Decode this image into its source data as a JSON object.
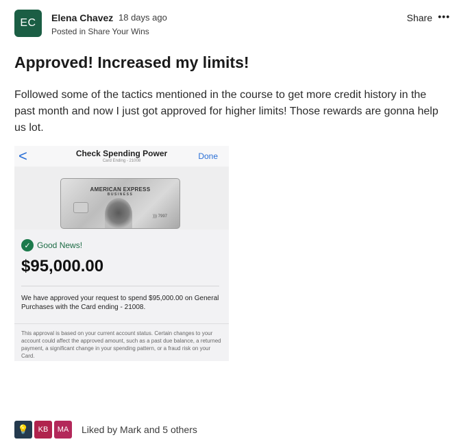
{
  "post": {
    "author_initials": "EC",
    "author_name": "Elena Chavez",
    "time_ago": "18 days ago",
    "posted_in": "Posted in Share Your Wins",
    "share_label": "Share",
    "more_label": "•••",
    "title": "Approved! Increased my limits!",
    "body": "Followed some of the tactics mentioned in the course to get more credit history in the past month and now I just got approved for higher limits! Those rewards are gonna help us lot.",
    "avatar_color": "#1b5e44"
  },
  "screenshot": {
    "back_icon": "<",
    "header_title": "Check Spending Power",
    "card_ending_small": "Card Ending - 21008",
    "done_label": "Done",
    "card_brand": "AMERICAN EXPRESS",
    "card_sub": "BUSINESS",
    "card_contactless": "))) 7997",
    "good_news": "Good News!",
    "amount": "$95,000.00",
    "approval_text": "We have approved your request to spend $95,000.00 on General Purchases with the Card ending - 21008.",
    "fine_print": "This approval is based on your current account status. Certain changes to your account could affect the approved amount, such as a past due balance, a returned payment, a significant change in your spending pattern, or a fraud risk on your Card."
  },
  "likes": {
    "avatars": [
      {
        "label": "💡",
        "color": "#243a4e"
      },
      {
        "label": "KB",
        "color": "#b0234d"
      },
      {
        "label": "MA",
        "color": "#b3285a"
      }
    ],
    "text": "Liked by Mark and 5 others"
  }
}
